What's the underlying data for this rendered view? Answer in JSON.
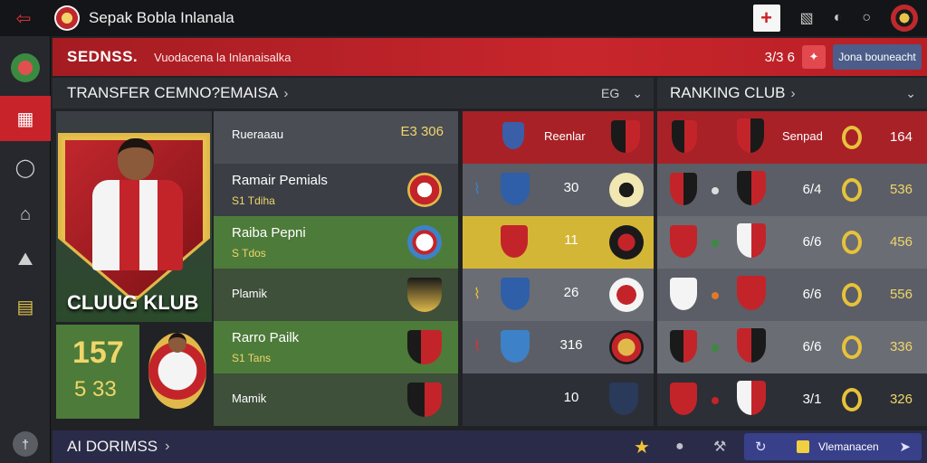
{
  "app": {
    "title": "Sepak Bobla Inlanala"
  },
  "topbar": {
    "back_icon": "back-arrow-icon",
    "plus_label": "+",
    "icons": [
      "shirt-icon",
      "sound-icon",
      "info-icon",
      "club-badge-icon"
    ]
  },
  "sidebar": {
    "items": [
      "club-logo-icon",
      "grid-icon",
      "chat-icon",
      "home-icon",
      "stadium-icon",
      "tactics-icon",
      "help-icon"
    ]
  },
  "banner": {
    "title": "SEDNSS.",
    "subtitle": "Vuodacena la Inlanaisalka",
    "value": "3/3 6",
    "icon": "coin-icon",
    "button_label": "Jona bouneacht"
  },
  "transfer": {
    "header": "TRANSFER CEMNO?EMAISA",
    "tools_label": "EG",
    "featured_club": "CLUUG KLUB",
    "stats_big": "157",
    "stats_small": "5 33",
    "rows": [
      {
        "name": "Rueraaau",
        "sub": "",
        "value": "E3 306"
      },
      {
        "name": "Ramair Pemials",
        "sub": "S1 Tdiha",
        "value": ""
      },
      {
        "name": "Raiba Pepni",
        "sub": "S Tdos",
        "value": ""
      },
      {
        "name": "Plamik",
        "sub": "",
        "value": ""
      },
      {
        "name": "Rarro Pailk",
        "sub": "S1 Tans",
        "value": ""
      },
      {
        "name": "Mamik",
        "sub": "",
        "value": ""
      }
    ]
  },
  "center": {
    "header": "Reenlar",
    "rows": [
      {
        "num": "30"
      },
      {
        "num": "11"
      },
      {
        "num": "26"
      },
      {
        "num": "316"
      },
      {
        "num": "10"
      }
    ]
  },
  "ranking": {
    "header": "RANKING CLUB",
    "col_label": "Senpad",
    "col_pts": "164",
    "rows": [
      {
        "score": "6/4",
        "pts": "536"
      },
      {
        "score": "6/6",
        "pts": "456"
      },
      {
        "score": "6/6",
        "pts": "556"
      },
      {
        "score": "6/6",
        "pts": "336"
      },
      {
        "score": "3/1",
        "pts": "326"
      }
    ]
  },
  "bottombar": {
    "label": "AI DORIMSS",
    "panel_label": "Vlemanacen"
  },
  "colors": {
    "accent_red": "#c8232a",
    "gold": "#f0d66a",
    "green": "#4d7b3a",
    "navy": "#2a2b48"
  }
}
